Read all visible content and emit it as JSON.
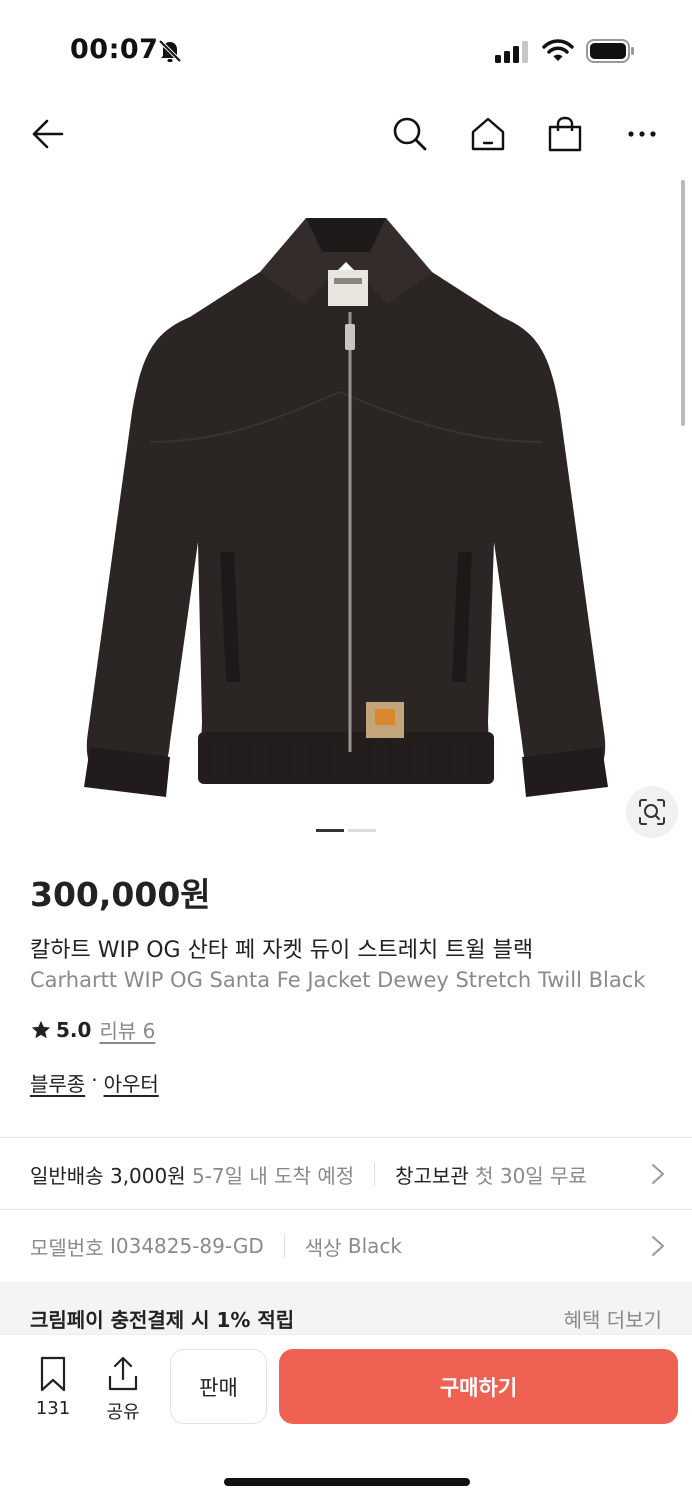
{
  "status_bar": {
    "time": "00:07",
    "icons": [
      "bell-off-icon",
      "cellular-signal-icon",
      "wifi-icon",
      "battery-icon"
    ]
  },
  "top_nav": {
    "icons": [
      "back-arrow-icon",
      "search-icon",
      "home-icon",
      "shopping-bag-icon",
      "more-icon"
    ]
  },
  "gallery": {
    "image_subject": "black twill zip-up jacket",
    "page_indicator": {
      "total": 2,
      "active": 1
    },
    "lens_icon": "image-search-icon"
  },
  "product": {
    "price": "300,000원",
    "name_ko": "칼하트 WIP OG 산타 페 자켓 듀이 스트레치 트윌 블랙",
    "name_en": "Carhartt WIP OG Santa Fe Jacket Dewey Stretch Twill Black",
    "rating": "5.0",
    "review_label": "리뷰 6",
    "category_1": "블루종",
    "category_sep": "·",
    "category_2": "아우터"
  },
  "shipping": {
    "type": "일반배송",
    "fee": "3,000원",
    "eta": "5-7일 내 도착 예정",
    "storage_label": "창고보관",
    "storage_offer": "첫 30일 무료"
  },
  "details": {
    "model_label": "모델번호",
    "model_value": "I034825-89-GD",
    "color_label": "색상",
    "color_value": "Black"
  },
  "benefit": {
    "title": "크림페이 충전결제 시 1% 적립",
    "more": "혜택 더보기"
  },
  "bottom_bar": {
    "bookmark_count": "131",
    "share_label": "공유",
    "sell_label": "판매",
    "buy_label": "구매하기"
  },
  "colors": {
    "accent": "#ef6253",
    "text": "#222222",
    "muted": "#8a8a8a"
  }
}
